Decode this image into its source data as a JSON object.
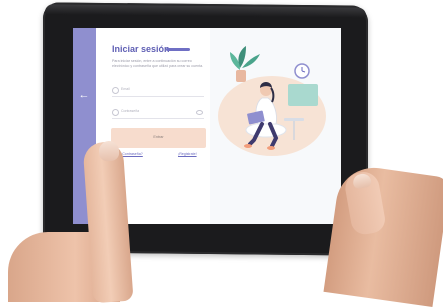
{
  "login": {
    "title": "Iniciar sesión",
    "subtitle": "Para iniciar sesión, entre a continuación su correo electrónico y contraseña que utilizó para crear su cuenta.",
    "email_placeholder": "Email",
    "password_placeholder": "Contraseña",
    "submit_label": "Entrar",
    "forgot_link": "¿Contraseña?",
    "register_link": "¡Registrate!"
  },
  "icons": {
    "back": "arrow-left-icon",
    "email": "user-icon",
    "password": "lock-icon",
    "visibility": "eye-icon"
  },
  "colors": {
    "sidebar": "#8f8fcf",
    "accent": "#5f5fb4",
    "button": "#f7dccd",
    "illustration_bg": "#f7e3d5"
  }
}
